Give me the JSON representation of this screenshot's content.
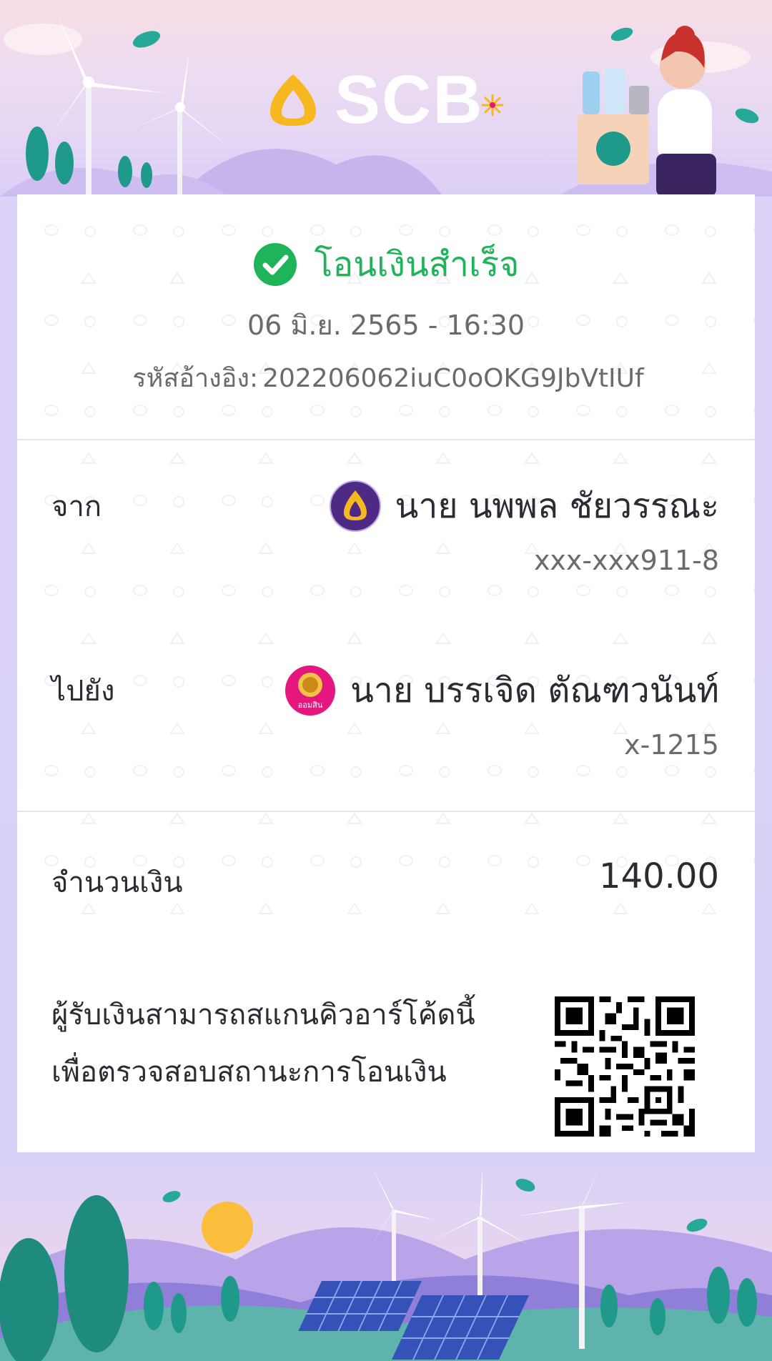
{
  "brand": {
    "name": "SCB"
  },
  "status": {
    "label": "โอนเงินสำเร็จ"
  },
  "transaction": {
    "datetime": "06 มิ.ย. 2565 - 16:30",
    "ref_label": "รหัสอ้างอิง:",
    "ref_value": "202206062iuC0oOKG9JbVtIUf"
  },
  "from": {
    "label": "จาก",
    "name": "นาย นพพล ชัยวรรณะ",
    "account": "xxx-xxx911-8",
    "bank_icon": "scb-bank-icon"
  },
  "to": {
    "label": "ไปยัง",
    "name": "นาย บรรเจิด ตัณฑวนันท์",
    "account": "x-1215",
    "bank_icon": "gsb-bank-icon",
    "bank_logo_text": "ออมสิน"
  },
  "amount": {
    "label": "จำนวนเงิน",
    "value": "140.00"
  },
  "qr": {
    "note_line1": "ผู้รับเงินสามารถสแกนคิวอาร์โค้ดนี้",
    "note_line2": "เพื่อตรวจสอบสถานะการโอนเงิน"
  },
  "colors": {
    "success": "#1fb35a",
    "scb_purple": "#4e2a84",
    "scb_gold": "#f5b81f",
    "gsb_pink": "#e5177e"
  }
}
